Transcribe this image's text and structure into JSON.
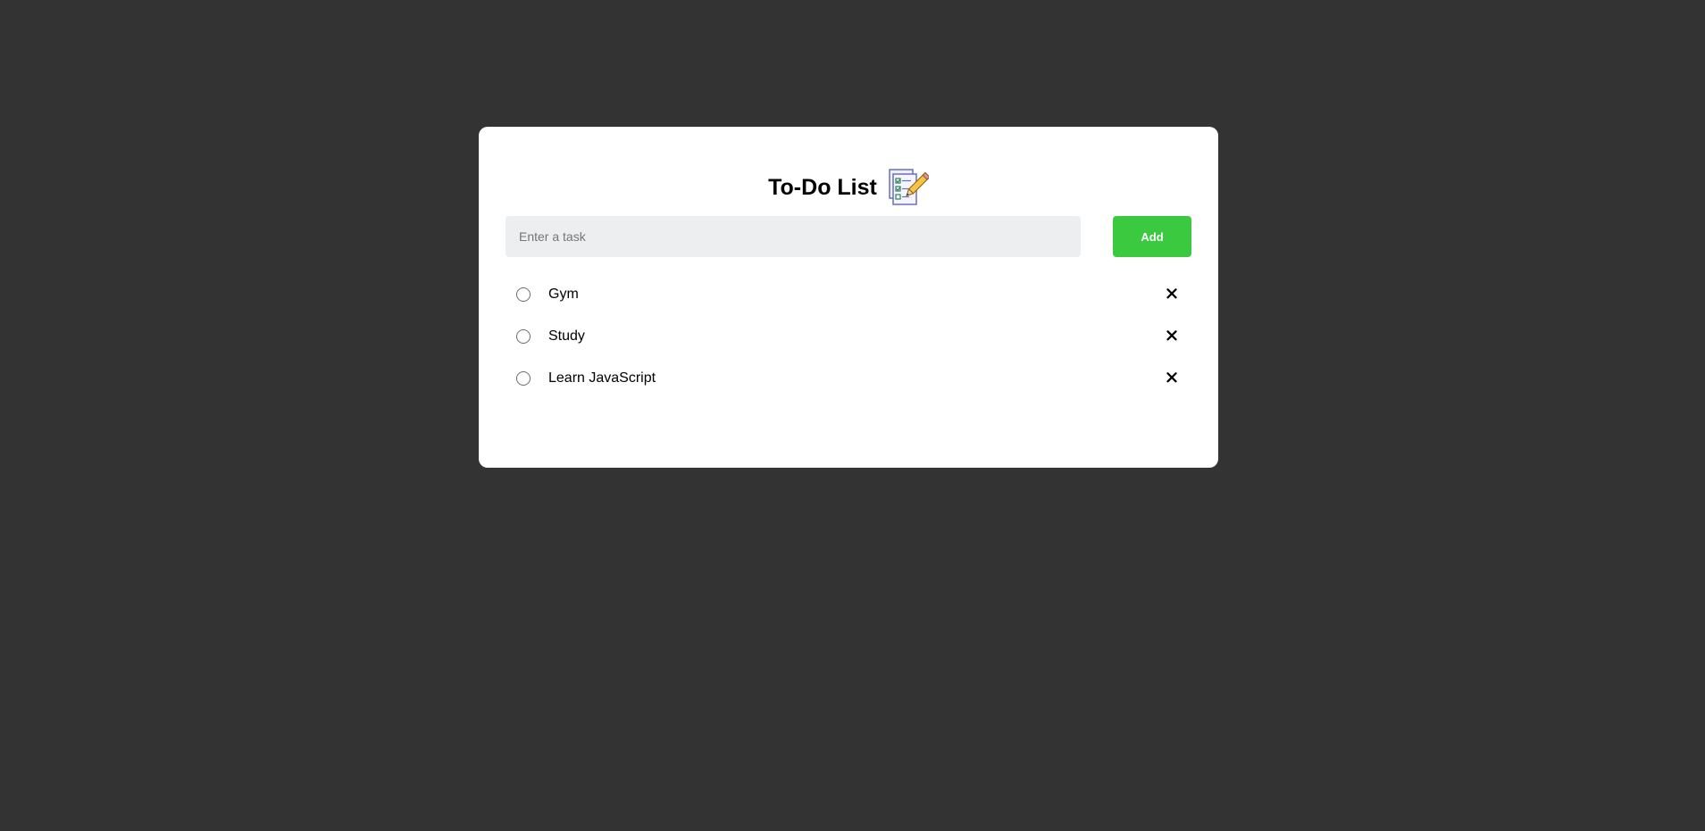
{
  "app": {
    "title": "To-Do List",
    "title_icon": "checklist-pencil-icon"
  },
  "input": {
    "value": "",
    "placeholder": "Enter a task"
  },
  "add_button": {
    "label": "Add",
    "color": "#3ac93f"
  },
  "tasks": [
    {
      "label": "Gym",
      "completed": false,
      "delete_icon": "close-icon"
    },
    {
      "label": "Study",
      "completed": false,
      "delete_icon": "close-icon"
    },
    {
      "label": "Learn JavaScript",
      "completed": false,
      "delete_icon": "close-icon"
    }
  ],
  "colors": {
    "background": "#333333",
    "card": "#ffffff",
    "input_bg": "#edeef0"
  }
}
